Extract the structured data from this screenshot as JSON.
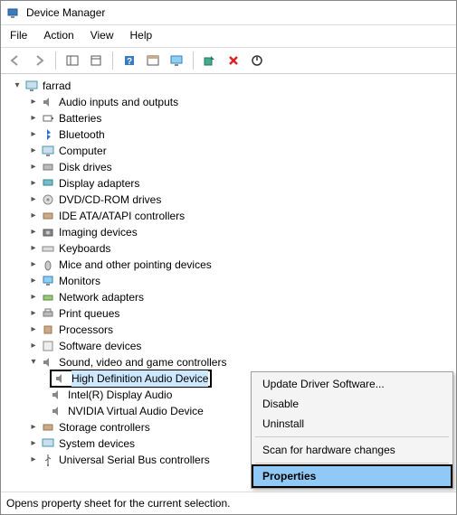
{
  "window": {
    "title": "Device Manager"
  },
  "menu": {
    "file": "File",
    "action": "Action",
    "view": "View",
    "help": "Help"
  },
  "tree": {
    "root": "farrad",
    "nodes": [
      "Audio inputs and outputs",
      "Batteries",
      "Bluetooth",
      "Computer",
      "Disk drives",
      "Display adapters",
      "DVD/CD-ROM drives",
      "IDE ATA/ATAPI controllers",
      "Imaging devices",
      "Keyboards",
      "Mice and other pointing devices",
      "Monitors",
      "Network adapters",
      "Print queues",
      "Processors",
      "Software devices",
      "Sound, video and game controllers",
      "Storage controllers",
      "System devices",
      "Universal Serial Bus controllers"
    ],
    "sound_children": {
      "hd": "High Definition Audio Device",
      "intel": "Intel(R) Display Audio",
      "nvidia": "NVIDIA Virtual Audio Device"
    }
  },
  "context": {
    "update": "Update Driver Software...",
    "disable": "Disable",
    "uninstall": "Uninstall",
    "scan": "Scan for hardware changes",
    "properties": "Properties"
  },
  "status": "Opens property sheet for the current selection."
}
